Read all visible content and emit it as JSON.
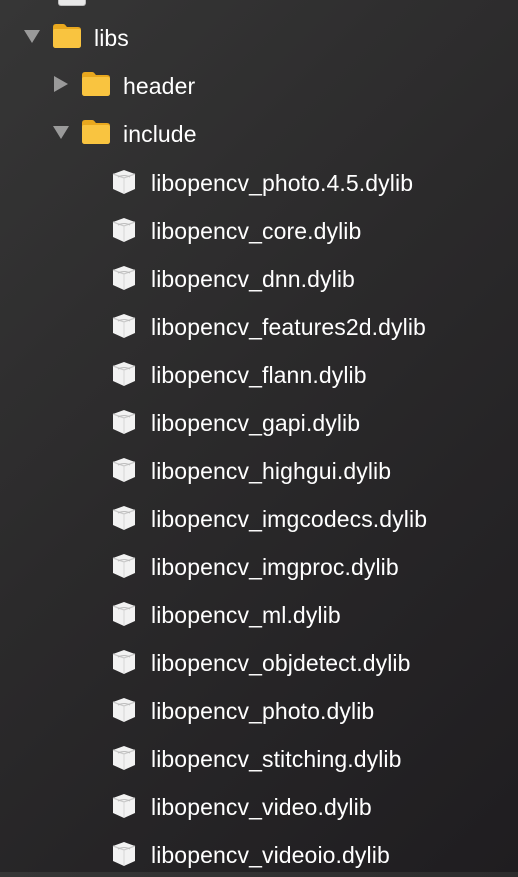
{
  "tree": {
    "libs": {
      "label": "libs",
      "expanded": true,
      "icon": "folder-icon"
    },
    "header": {
      "label": "header",
      "expanded": false,
      "icon": "folder-icon"
    },
    "include": {
      "label": "include",
      "expanded": true,
      "icon": "folder-icon"
    },
    "files": [
      {
        "label": "libopencv_photo.4.5.dylib",
        "icon": "library-file-icon"
      },
      {
        "label": "libopencv_core.dylib",
        "icon": "library-file-icon"
      },
      {
        "label": "libopencv_dnn.dylib",
        "icon": "library-file-icon"
      },
      {
        "label": "libopencv_features2d.dylib",
        "icon": "library-file-icon"
      },
      {
        "label": "libopencv_flann.dylib",
        "icon": "library-file-icon"
      },
      {
        "label": "libopencv_gapi.dylib",
        "icon": "library-file-icon"
      },
      {
        "label": "libopencv_highgui.dylib",
        "icon": "library-file-icon"
      },
      {
        "label": "libopencv_imgcodecs.dylib",
        "icon": "library-file-icon"
      },
      {
        "label": "libopencv_imgproc.dylib",
        "icon": "library-file-icon"
      },
      {
        "label": "libopencv_ml.dylib",
        "icon": "library-file-icon"
      },
      {
        "label": "libopencv_objdetect.dylib",
        "icon": "library-file-icon"
      },
      {
        "label": "libopencv_photo.dylib",
        "icon": "library-file-icon"
      },
      {
        "label": "libopencv_stitching.dylib",
        "icon": "library-file-icon"
      },
      {
        "label": "libopencv_video.dylib",
        "icon": "library-file-icon"
      },
      {
        "label": "libopencv_videoio.dylib",
        "icon": "library-file-icon"
      }
    ]
  },
  "colors": {
    "folder": "#f9c440",
    "folder_dark": "#e9a81e",
    "disclosure": "#9a9a9a",
    "text": "#ffffff",
    "file_icon": "#f2f2f2"
  }
}
